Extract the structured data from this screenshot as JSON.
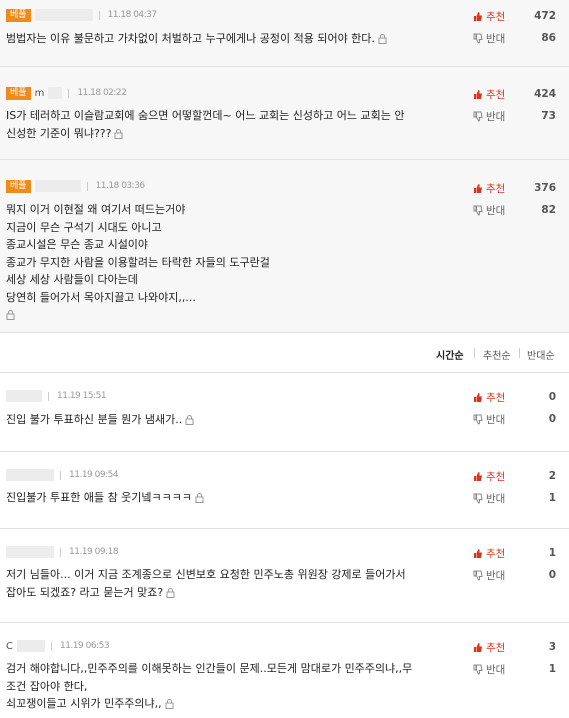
{
  "best_badge": "베플",
  "vote_up_label": "추천",
  "vote_down_label": "반대",
  "best_comments": [
    {
      "nick": "",
      "time": "11.18 04:37",
      "text": "범법자는 이유 불문하고 가차없이 처벌하고 누구에게나 공정이 적용 되어야 한다.",
      "up": "472",
      "down": "86"
    },
    {
      "nick": "m",
      "time": "11.18 02:22",
      "text": "IS가 테러하고 이슬람교회에 숨으면 어떻할껀데~ 어느 교회는 신성하고 어느 교회는 안\n신성한 기준이 뭐냐???",
      "up": "424",
      "down": "73"
    },
    {
      "nick": "",
      "time": "11.18 03:36",
      "text": "뭐지 이거 이현절 왜 여기서 떠드는거야\n지금이 무슨 구석기 시대도 아니고\n종교시설은 무슨 종교 시설이야\n종교가 무지한 사람을 이용할려는 타락한 자들의 도구란걸\n세상 세상 사람들이 다아는데\n당연히 들어가서 목아지끌고 나와야지,,...",
      "up": "376",
      "down": "82"
    }
  ],
  "sort_tabs": [
    "시간순",
    "추천순",
    "반대순"
  ],
  "comments": [
    {
      "nick": "",
      "time": "11.19 15:51",
      "text": "진입 불가 투표하신 분들 뭔가 냄새가..",
      "up": "0",
      "down": "0"
    },
    {
      "nick": "",
      "time": "11.19 09:54",
      "text": "진입불가 투표한 애들 참 웃기넼ㅋㅋㅋㅋ",
      "up": "2",
      "down": "1"
    },
    {
      "nick": "",
      "time": "11.19 09:18",
      "text": "저기 님들아... 이거 지금 조계종으로 신변보호 요청한 민주노총 위원장 강제로 들어가서\n잡아도 되겠죠? 라고 묻는거 맞죠?",
      "up": "1",
      "down": "0"
    },
    {
      "nick": "C",
      "time": "11.19 06:53",
      "text": "검거 해야합니다,,민주주의를 이해못하는 인간들이 문제..모든게 맘대로가 민주주의냐,,무\n조건 잡아야 한다,\n쇠꼬쟁이들고 시위가 민주주의냐,,",
      "up": "3",
      "down": "1"
    }
  ],
  "colors": {
    "badge": "#f08a1c",
    "up": "#d9341f",
    "down": "#666666"
  }
}
